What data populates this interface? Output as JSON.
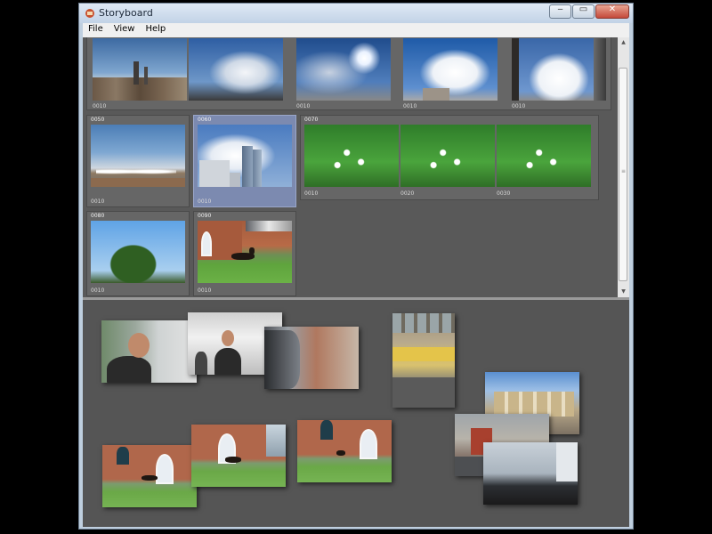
{
  "window": {
    "title": "Storyboard",
    "minimize_glyph": "‒",
    "maximize_glyph": "▭",
    "close_glyph": "✕"
  },
  "menu": {
    "items": [
      "File",
      "View",
      "Help"
    ]
  },
  "storyboard": {
    "groups": [
      {
        "label": "",
        "shots": [
          "0010",
          "",
          "0010",
          "0010",
          "0010"
        ]
      },
      {
        "label": "0050",
        "shots": [
          "0010"
        ]
      },
      {
        "label": "0060",
        "shots": [
          "0010"
        ],
        "selected": true
      },
      {
        "label": "0070",
        "shots": [
          "0010",
          "0020",
          "0030"
        ]
      },
      {
        "label": "0080",
        "shots": [
          "0010"
        ]
      },
      {
        "label": "0090",
        "shots": [
          "0010"
        ]
      }
    ]
  },
  "scrollbar": {
    "up_glyph": "▲",
    "down_glyph": "▼",
    "grip_glyph": "≡"
  },
  "icons": {
    "app": "storyboard-app-icon"
  }
}
